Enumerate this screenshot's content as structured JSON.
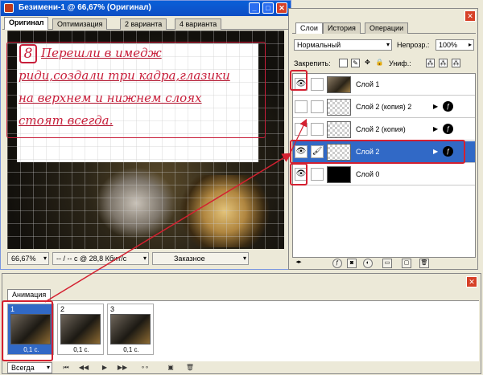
{
  "doc": {
    "title": "Безимени-1 @ 66,67% (Оригинал)",
    "tabs": [
      "Оригинал",
      "Оптимизация",
      "2 варианта",
      "4 варианта"
    ],
    "status_zoom": "66,67%",
    "status_info": "-- / -- с @ 28,8 Кбит/с",
    "status_custom": "Заказное"
  },
  "note": {
    "number": "8",
    "lines": [
      "Перешли в имедж",
      "риди,создали три кадра,глазики",
      "на верхнем и нижнем слоях",
      "стоят всегда."
    ]
  },
  "layers_panel": {
    "tabs": [
      "Слои",
      "История",
      "Операции"
    ],
    "blend_mode": "Нормальный",
    "opacity_label": "Непрозр.:",
    "opacity_value": "100%",
    "lock_label": "Закрепить:",
    "unify_label": "Униф.:",
    "layers": [
      {
        "name": "Слой 1",
        "visible": true,
        "fx": false,
        "thumb": "photo",
        "selected": false
      },
      {
        "name": "Слой 2 (копия) 2",
        "visible": false,
        "fx": true,
        "thumb": "transparent",
        "selected": false
      },
      {
        "name": "Слой 2 (копия)",
        "visible": false,
        "fx": true,
        "thumb": "transparent",
        "selected": false
      },
      {
        "name": "Слой 2",
        "visible": true,
        "fx": true,
        "thumb": "transparent",
        "selected": true
      },
      {
        "name": "Слой 0",
        "visible": true,
        "fx": false,
        "thumb": "black",
        "selected": false
      }
    ]
  },
  "animation_panel": {
    "tab": "Анимация",
    "frames": [
      {
        "num": "1",
        "delay": "0,1 с."
      },
      {
        "num": "2",
        "delay": "0,1 с."
      },
      {
        "num": "3",
        "delay": "0,1 с."
      }
    ],
    "loop": "Всегда"
  },
  "colors": {
    "annotation_red": "#d42030",
    "selection_blue": "#3169c6",
    "titlebar_blue": "#0a5fd8"
  }
}
